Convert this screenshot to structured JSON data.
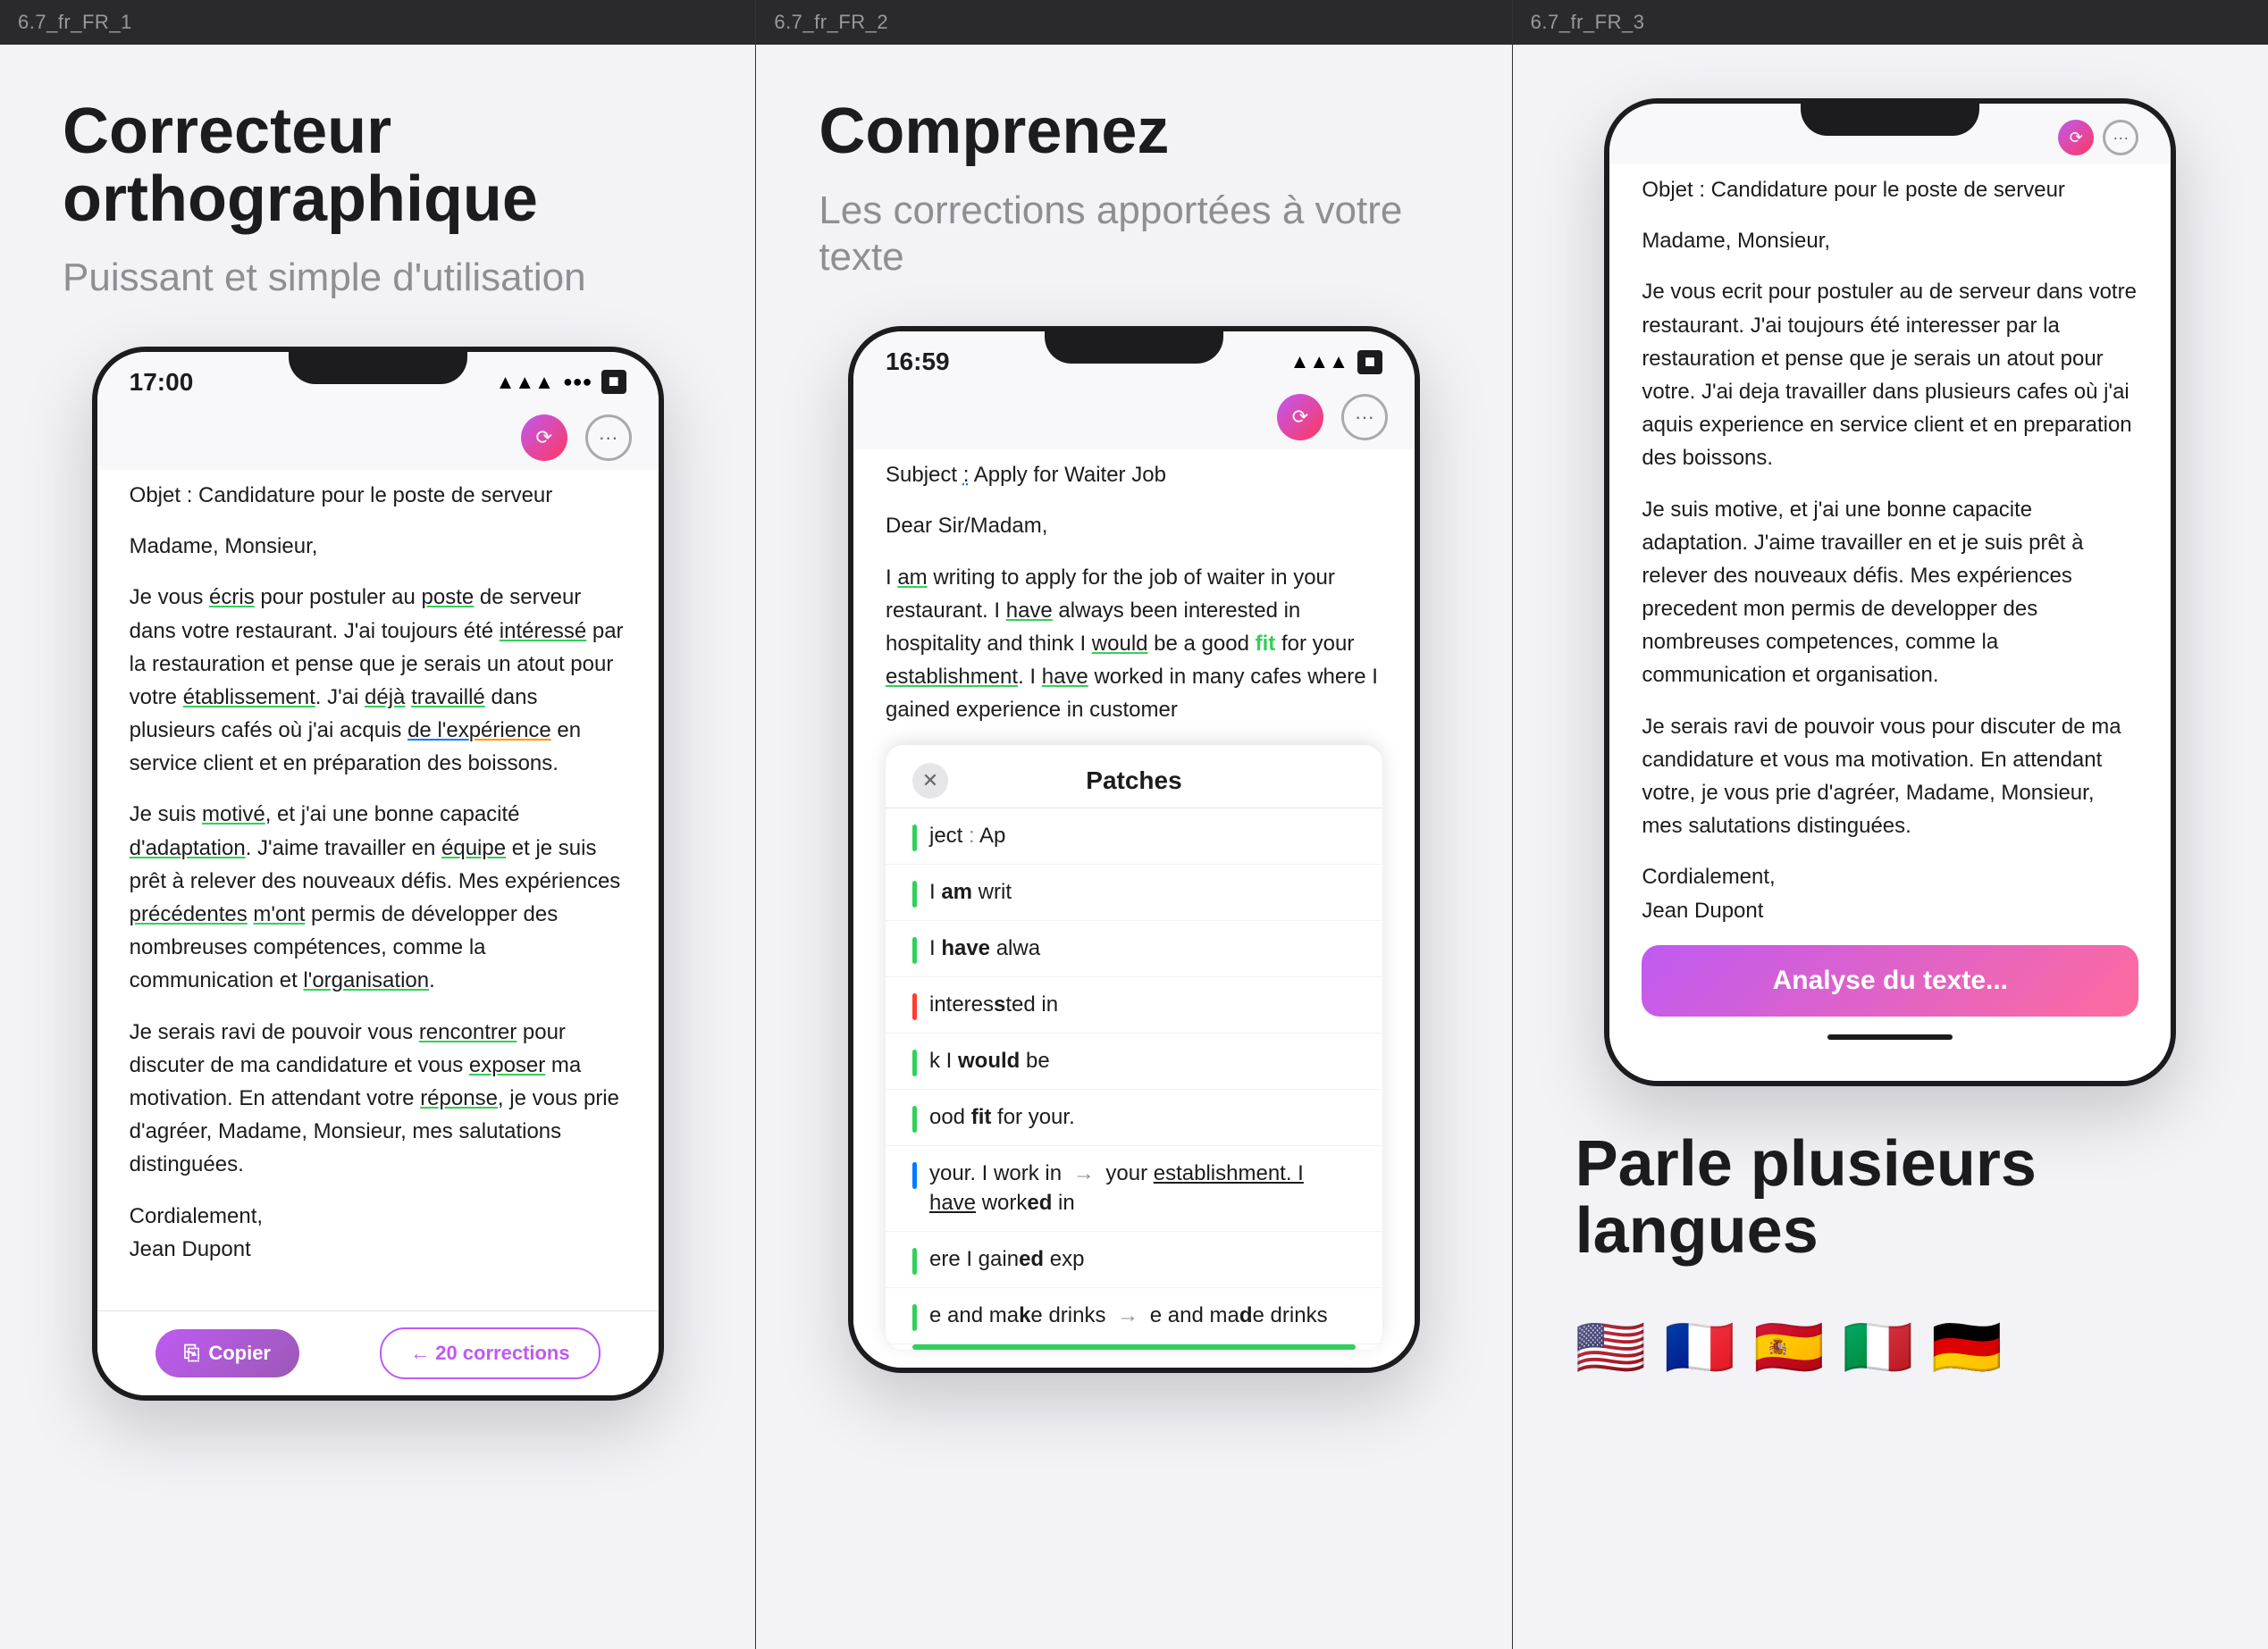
{
  "panels": [
    {
      "id": "panel1",
      "header_label": "6.7_fr_FR_1",
      "title": "Correcteur orthographique",
      "subtitle": "Puissant et simple d'utilisation",
      "phone": {
        "time": "17:00",
        "subject_line": "Objet : Candidature pour le poste de serveur",
        "greeting": "Madame, Monsieur,",
        "paragraphs": [
          "Je vous écris pour postuler au poste de serveur dans votre restaurant. J'ai toujours été intéressé par la restauration et pense que je serais un atout pour votre établissement. J'ai déjà travaillé dans plusieurs cafés où j'ai acquis de l'expérience en service client et en préparation des boissons.",
          "Je suis motivé, et j'ai une bonne capacité d'adaptation. J'aime travailler en équipe et je suis prêt à relever des nouveaux défis. Mes expériences précédentes m'ont permis de développer des nombreuses compétences, comme la communication et l'organisation.",
          "Je serais ravi de pouvoir vous rencontrer pour discuter de ma candidature et vous exposer ma motivation. En attendant votre réponse, je vous prie d'agréer, Madame, Monsieur, mes salutations distinguées.",
          "Cordialement,\nJean Dupont"
        ],
        "bottom_buttons": [
          "Copier",
          "20 corrections"
        ]
      }
    },
    {
      "id": "panel2",
      "header_label": "6.7_fr_FR_2",
      "title": "Comprenez",
      "subtitle": "Les corrections apportées à votre texte",
      "phone": {
        "time": "16:59",
        "subject_line": "Subject : Apply for Waiter Job",
        "greeting": "Dear Sir/Madam,",
        "body_preview": "I am writing to apply for the job of waiter in your restaurant. I have always been interested in hospitality and think I would be a good fit for your establishment. I have worked in many cafes where I gained experience in customer",
        "patches_title": "Patches",
        "patches": [
          {
            "color": "green",
            "text": "ject : Ap"
          },
          {
            "color": "green",
            "text": "I am writ"
          },
          {
            "color": "green",
            "text": "I have alwa"
          },
          {
            "color": "red",
            "text": "interessted in"
          },
          {
            "color": "green",
            "text": "k I would be"
          },
          {
            "color": "green",
            "text": "ood fit for your."
          },
          {
            "color": "blue",
            "text": "your. I work in → your establishment. I have worked in"
          },
          {
            "color": "green",
            "text": "ere I gained exp"
          },
          {
            "color": "green",
            "text": "e and make drinks → e and made drinks"
          }
        ]
      }
    },
    {
      "id": "panel3",
      "header_label": "6.7_fr_FR_3",
      "title": "Parle plusieurs langues",
      "phone": {
        "subject_line": "Objet : Candidature pour le poste de serveur",
        "greeting": "Madame, Monsieur,",
        "paragraphs": [
          "Je vous ecrit pour postuler au de serveur dans votre restaurant. J'ai toujours été interesser par la restauration et pense que je serais un atout pour votre. J'ai deja travailler dans plusieurs cafes où j'ai aquis experience en service client et en preparation des boissons.",
          "Je suis motive, et j'ai une bonne capacite adaptation. J'aime travailler en et je suis prêt à relever des nouveaux défis. Mes expériences precedent mon permis de developper des nombreuses competences, comme la communication et organisation.",
          "Je serais ravi de pouvoir vous pour discuter de ma candidature et vous ma motivation. En attendant votre, je vous prie d'agréer, Madame, Monsieur, mes salutations distinguées.",
          "Cordialement,\nJean Dupont"
        ],
        "analysis_button": "Analyse du texte..."
      },
      "flags": [
        "🇺🇸",
        "🇫🇷",
        "🇪🇸",
        "🇮🇹",
        "🇩🇪"
      ]
    }
  ]
}
